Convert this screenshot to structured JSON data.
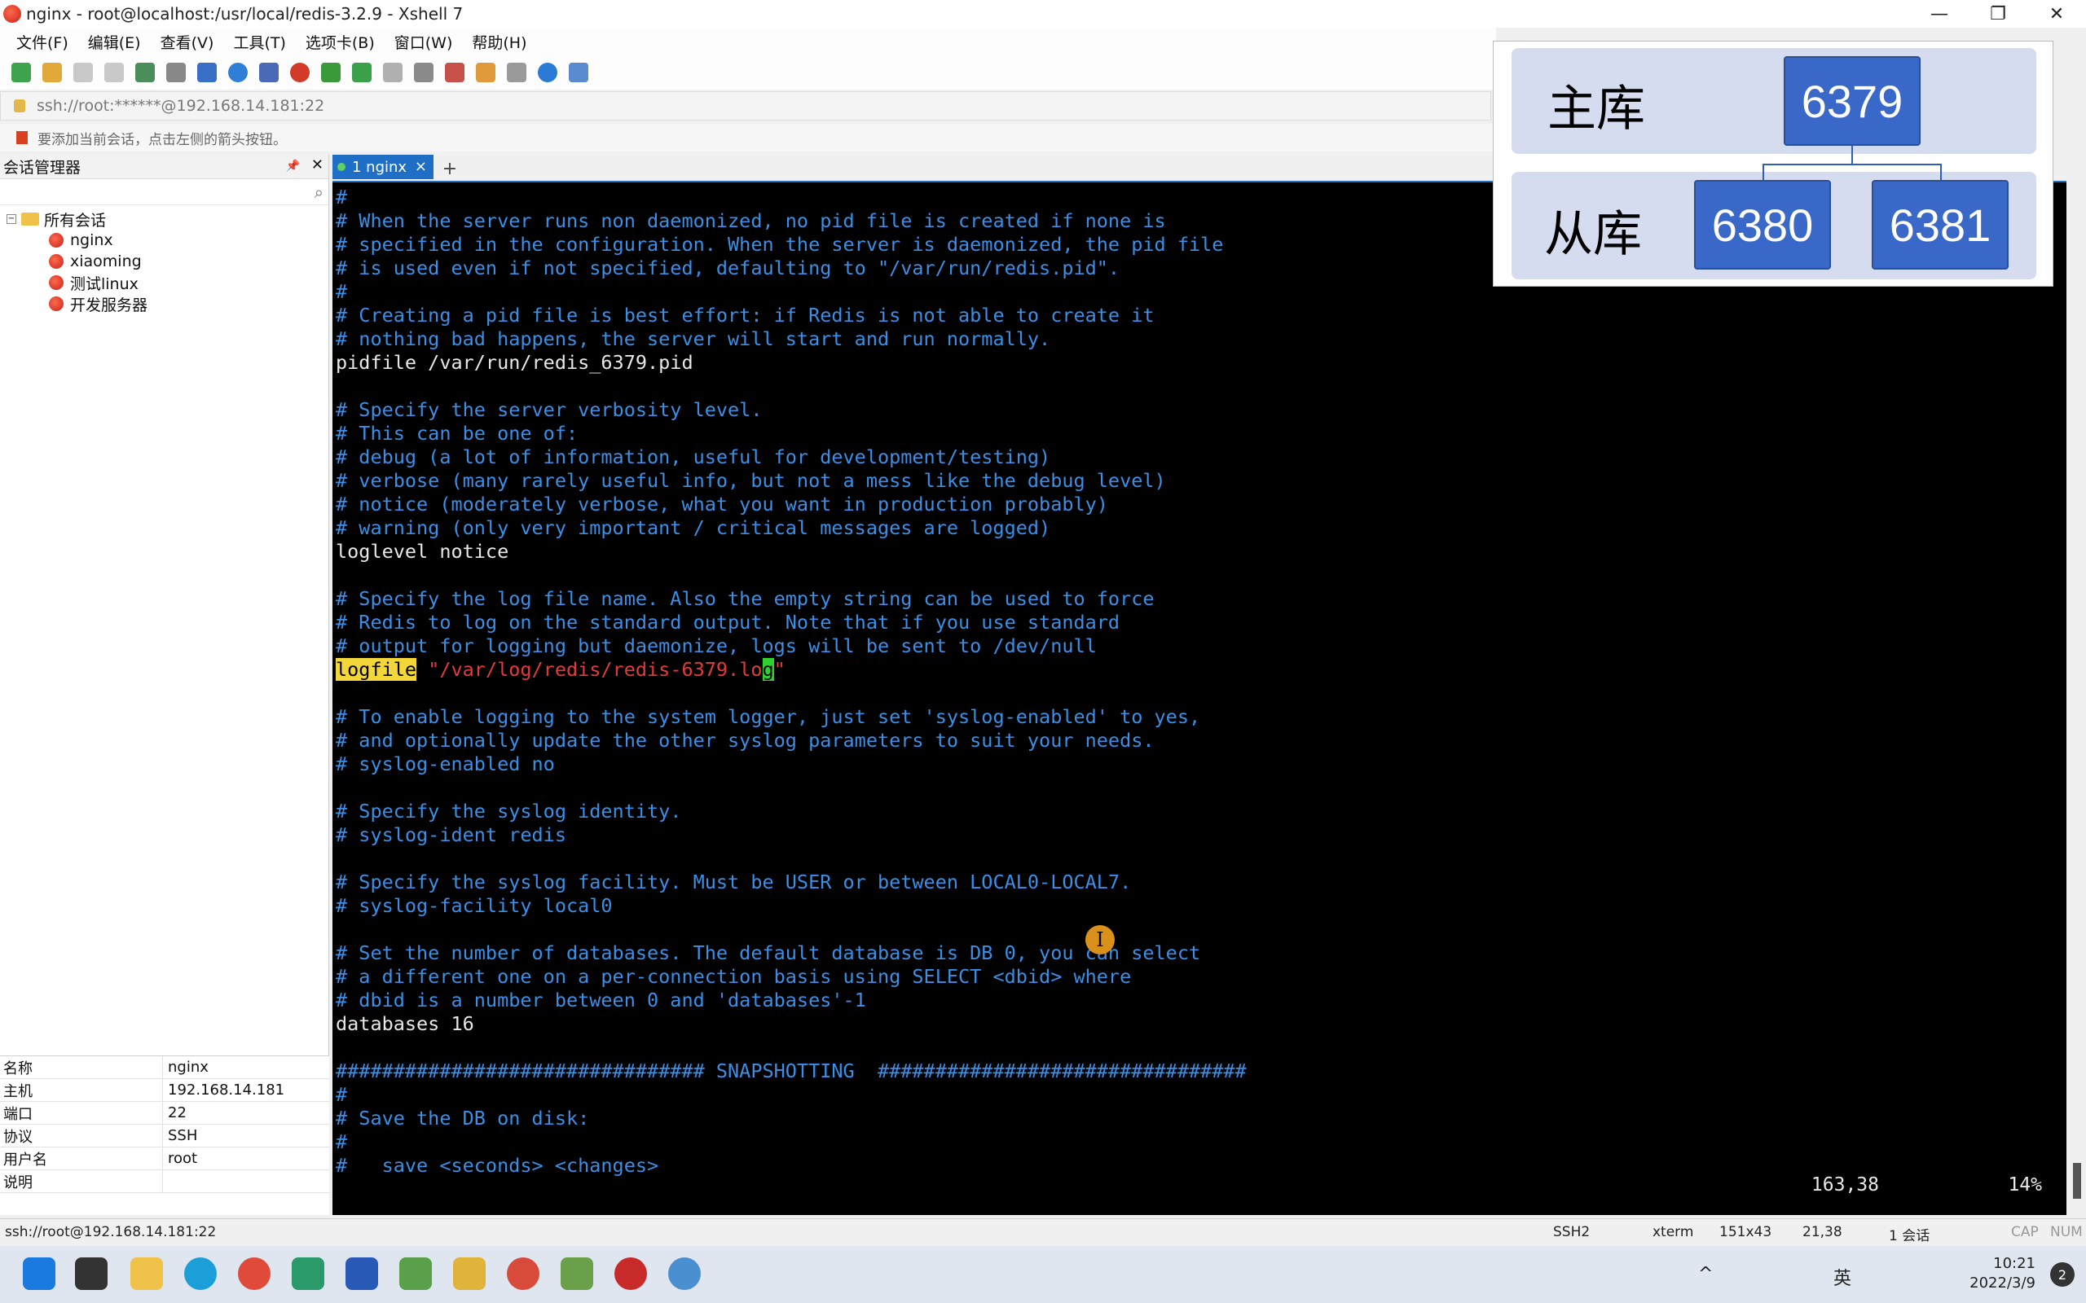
{
  "window": {
    "title": "nginx - root@localhost:/usr/local/redis-3.2.9 - Xshell 7",
    "minimize": "—",
    "restore": "❐",
    "close": "✕"
  },
  "menu": [
    "文件(F)",
    "编辑(E)",
    "查看(V)",
    "工具(T)",
    "选项卡(B)",
    "窗口(W)",
    "帮助(H)"
  ],
  "address": "ssh://root:******@192.168.14.181:22",
  "hint": "要添加当前会话，点击左侧的箭头按钮。",
  "session_manager": {
    "title": "会话管理器",
    "pin": "📌",
    "close": "✕",
    "root": "所有会话",
    "sessions": [
      "nginx",
      "xiaoming",
      "测试linux",
      "开发服务器"
    ]
  },
  "properties": [
    {
      "k": "名称",
      "v": "nginx"
    },
    {
      "k": "主机",
      "v": "192.168.14.181"
    },
    {
      "k": "端口",
      "v": "22"
    },
    {
      "k": "协议",
      "v": "SSH"
    },
    {
      "k": "用户名",
      "v": "root"
    },
    {
      "k": "说明",
      "v": ""
    }
  ],
  "tab": {
    "label": "1 nginx",
    "close": "×",
    "add": "+"
  },
  "terminal": {
    "lines": [
      {
        "t": "#",
        "s": "c"
      },
      {
        "t": "# When the server runs non daemonized, no pid file is created if none is",
        "s": "c"
      },
      {
        "t": "# specified in the configuration. When the server is daemonized, the pid file",
        "s": "c"
      },
      {
        "t": "# is used even if not specified, defaulting to \"/var/run/redis.pid\".",
        "s": "c"
      },
      {
        "t": "#",
        "s": "c"
      },
      {
        "t": "# Creating a pid file is best effort: if Redis is not able to create it",
        "s": "c"
      },
      {
        "t": "# nothing bad happens, the server will start and run normally.",
        "s": "c"
      },
      {
        "t": "pidfile /var/run/redis_6379.pid",
        "s": "w"
      },
      {
        "t": "",
        "s": "w"
      },
      {
        "t": "# Specify the server verbosity level.",
        "s": "c"
      },
      {
        "t": "# This can be one of:",
        "s": "c"
      },
      {
        "t": "# debug (a lot of information, useful for development/testing)",
        "s": "c"
      },
      {
        "t": "# verbose (many rarely useful info, but not a mess like the debug level)",
        "s": "c"
      },
      {
        "t": "# notice (moderately verbose, what you want in production probably)",
        "s": "c"
      },
      {
        "t": "# warning (only very important / critical messages are logged)",
        "s": "c"
      },
      {
        "t": "loglevel notice",
        "s": "w"
      },
      {
        "t": "",
        "s": "w"
      },
      {
        "t": "# Specify the log file name. Also the empty string can be used to force",
        "s": "c"
      },
      {
        "t": "# Redis to log on the standard output. Note that if you use standard",
        "s": "c"
      },
      {
        "t": "# output for logging but daemonize, logs will be sent to /dev/null",
        "s": "c"
      },
      {
        "t": "LOGFILE",
        "s": "special"
      },
      {
        "t": "",
        "s": "w"
      },
      {
        "t": "# To enable logging to the system logger, just set 'syslog-enabled' to yes,",
        "s": "c"
      },
      {
        "t": "# and optionally update the other syslog parameters to suit your needs.",
        "s": "c"
      },
      {
        "t": "# syslog-enabled no",
        "s": "c"
      },
      {
        "t": "",
        "s": "w"
      },
      {
        "t": "# Specify the syslog identity.",
        "s": "c"
      },
      {
        "t": "# syslog-ident redis",
        "s": "c"
      },
      {
        "t": "",
        "s": "w"
      },
      {
        "t": "# Specify the syslog facility. Must be USER or between LOCAL0-LOCAL7.",
        "s": "c"
      },
      {
        "t": "# syslog-facility local0",
        "s": "c"
      },
      {
        "t": "",
        "s": "w"
      },
      {
        "t": "# Set the number of databases. The default database is DB 0, you can select",
        "s": "c"
      },
      {
        "t": "# a different one on a per-connection basis using SELECT <dbid> where",
        "s": "c"
      },
      {
        "t": "# dbid is a number between 0 and 'databases'-1",
        "s": "c"
      },
      {
        "t": "databases 16",
        "s": "w"
      },
      {
        "t": "",
        "s": "w"
      },
      {
        "t": "################################ SNAPSHOTTING  ################################",
        "s": "c"
      },
      {
        "t": "#",
        "s": "c"
      },
      {
        "t": "# Save the DB on disk:",
        "s": "c"
      },
      {
        "t": "#",
        "s": "c"
      },
      {
        "t": "#   save <seconds> <changes>",
        "s": "c"
      }
    ],
    "logfile_keyword": "logfile",
    "logfile_path": "\"/var/log/redis/redis-6379.lo",
    "logfile_cursor": "g",
    "logfile_end": "\"",
    "cursor_pos": "163,38",
    "percent": "14%",
    "ibeam": "I"
  },
  "overlay": {
    "master_label": "主库",
    "slave_label": "从库",
    "master_port": "6379",
    "slave_ports": [
      "6380",
      "6381"
    ],
    "band_color": "#d6dcf0",
    "box_color": "#3a68c8"
  },
  "statusbar": {
    "left": "ssh://root@192.168.14.181:22",
    "protocol": "SSH2",
    "term": "xterm",
    "size": "151x43",
    "pos": "21,38",
    "sessions": "1 会话",
    "cap": "CAP",
    "num": "NUM"
  },
  "taskbar": {
    "tray_ime": "英",
    "time": "10:21",
    "date": "2022/3/9",
    "notif": "2"
  },
  "colors": {
    "terminal_bg": "#000000",
    "comment": "#3b8fe6",
    "tab_active": "#1f6fc7"
  }
}
